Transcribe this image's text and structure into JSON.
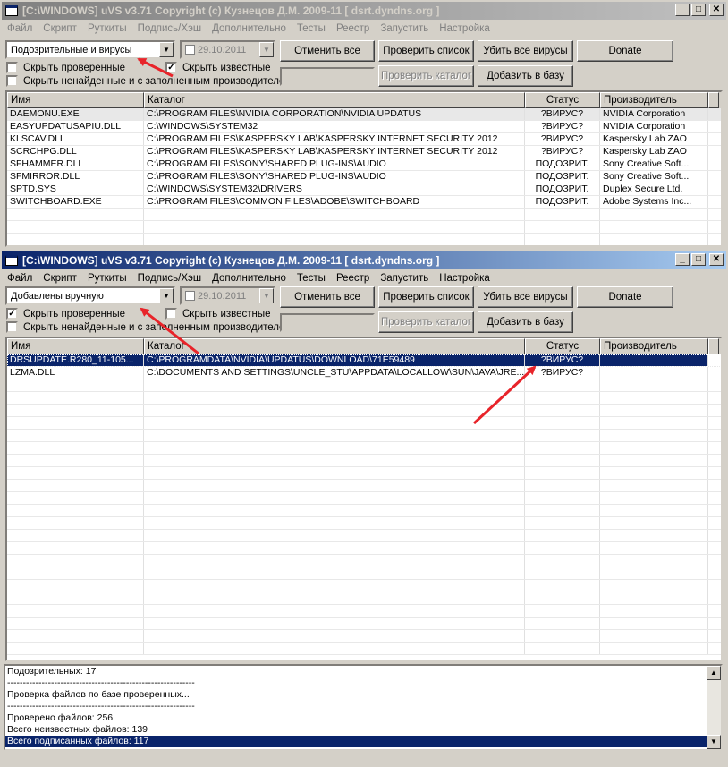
{
  "top_window": {
    "title": "[C:\\WINDOWS] uVS v3.71 Copyright (c) Кузнецов Д.М. 2009-11 [ dsrt.dyndns.org ]",
    "menu": [
      "Файл",
      "Скрипт",
      "Руткиты",
      "Подпись/Хэш",
      "Дополнительно",
      "Тесты",
      "Реестр",
      "Запустить",
      "Настройка"
    ],
    "filter_value": "Подозрительные и вирусы",
    "date_value": "29.10.2011",
    "buttons": {
      "cancel_all": "Отменить все",
      "check_list": "Проверить список",
      "kill_all": "Убить все вирусы",
      "donate": "Donate",
      "check_dir": "Проверить каталог",
      "add_db": "Добавить в базу"
    },
    "checks": {
      "hide_checked": "Скрыть проверенные",
      "hide_known": "Скрыть известные",
      "hide_notfound": "Скрыть ненайденные и с заполненным производителем"
    },
    "check_state": {
      "hide_checked": false,
      "hide_known": true,
      "hide_notfound": false
    },
    "columns": [
      "Имя",
      "Каталог",
      "Статус",
      "Производитель"
    ],
    "rows": [
      [
        "DAEMONU.EXE",
        "C:\\PROGRAM FILES\\NVIDIA CORPORATION\\NVIDIA UPDATUS",
        "?ВИРУС?",
        "NVIDIA Corporation"
      ],
      [
        "EASYUPDATUSAPIU.DLL",
        "C:\\WINDOWS\\SYSTEM32",
        "?ВИРУС?",
        "NVIDIA Corporation"
      ],
      [
        "KLSCAV.DLL",
        "C:\\PROGRAM FILES\\KASPERSKY LAB\\KASPERSKY INTERNET SECURITY 2012",
        "?ВИРУС?",
        "Kaspersky Lab ZAO"
      ],
      [
        "SCRCHPG.DLL",
        "C:\\PROGRAM FILES\\KASPERSKY LAB\\KASPERSKY INTERNET SECURITY 2012",
        "?ВИРУС?",
        "Kaspersky Lab ZAO"
      ],
      [
        "SFHAMMER.DLL",
        "C:\\PROGRAM FILES\\SONY\\SHARED PLUG-INS\\AUDIO",
        "ПОДОЗРИТ.",
        "Sony Creative Soft..."
      ],
      [
        "SFMIRROR.DLL",
        "C:\\PROGRAM FILES\\SONY\\SHARED PLUG-INS\\AUDIO",
        "ПОДОЗРИТ.",
        "Sony Creative Soft..."
      ],
      [
        "SPTD.SYS",
        "C:\\WINDOWS\\SYSTEM32\\DRIVERS",
        "ПОДОЗРИТ.",
        "Duplex Secure Ltd."
      ],
      [
        "SWITCHBOARD.EXE",
        "C:\\PROGRAM FILES\\COMMON FILES\\ADOBE\\SWITCHBOARD",
        "ПОДОЗРИТ.",
        "Adobe Systems Inc..."
      ]
    ]
  },
  "bottom_window": {
    "title": "[C:\\WINDOWS] uVS v3.71 Copyright (c) Кузнецов Д.М. 2009-11 [ dsrt.dyndns.org ]",
    "menu": [
      "Файл",
      "Скрипт",
      "Руткиты",
      "Подпись/Хэш",
      "Дополнительно",
      "Тесты",
      "Реестр",
      "Запустить",
      "Настройка"
    ],
    "filter_value": "Добавлены вручную",
    "date_value": "29.10.2011",
    "buttons": {
      "cancel_all": "Отменить все",
      "check_list": "Проверить список",
      "kill_all": "Убить все вирусы",
      "donate": "Donate",
      "check_dir": "Проверить каталог",
      "add_db": "Добавить в базу"
    },
    "checks": {
      "hide_checked": "Скрыть проверенные",
      "hide_known": "Скрыть известные",
      "hide_notfound": "Скрыть ненайденные и с заполненным производителем"
    },
    "check_state": {
      "hide_checked": true,
      "hide_known": false,
      "hide_notfound": false
    },
    "columns": [
      "Имя",
      "Каталог",
      "Статус",
      "Производитель"
    ],
    "rows": [
      [
        "DRSUPDATE.R280_11-105...",
        "C:\\PROGRAMDATA\\NVIDIA\\UPDATUS\\DOWNLOAD\\71E59489",
        "?ВИРУС?",
        ""
      ],
      [
        "LZMA.DLL",
        "C:\\DOCUMENTS AND SETTINGS\\UNCLE_STU\\APPDATA\\LOCALLOW\\SUN\\JAVA\\JRE...",
        "?ВИРУС?",
        ""
      ]
    ],
    "log": [
      "Подозрительных: 17",
      "------------------------------------------------------------",
      "Проверка файлов по базе проверенных...",
      "------------------------------------------------------------",
      "Проверено файлов: 256",
      "Всего неизвестных файлов: 139",
      "Всего подписанных файлов: 117"
    ]
  },
  "colors": {
    "annotation_arrow": "#e8242a",
    "selection": "#0a246a",
    "window_bg": "#d4d0c8"
  }
}
